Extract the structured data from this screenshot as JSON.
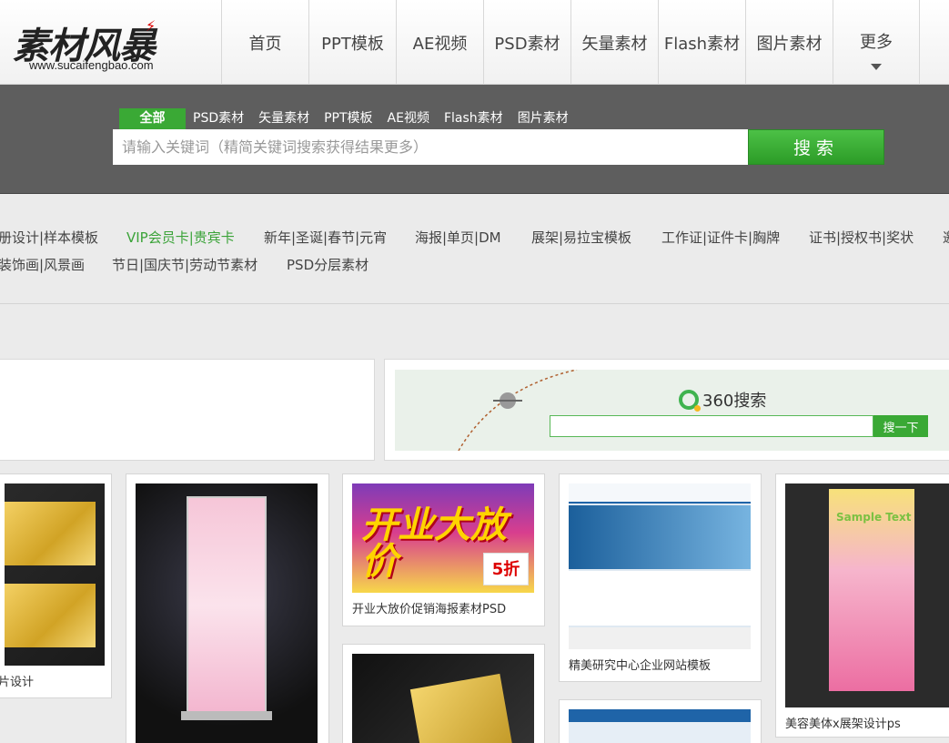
{
  "logo": {
    "name": "素材风暴",
    "url": "www.sucaifengbao.com"
  },
  "nav": [
    {
      "label": "首页"
    },
    {
      "label": "PPT模板"
    },
    {
      "label": "AE视频"
    },
    {
      "label": "PSD素材"
    },
    {
      "label": "矢量素材"
    },
    {
      "label": "Flash素材"
    },
    {
      "label": "图片素材"
    },
    {
      "label": "更多"
    }
  ],
  "search": {
    "tabs": [
      {
        "label": "全部",
        "active": true
      },
      {
        "label": "PSD素材"
      },
      {
        "label": "矢量素材"
      },
      {
        "label": "PPT模板"
      },
      {
        "label": "AE视频"
      },
      {
        "label": "Flash素材"
      },
      {
        "label": "图片素材"
      }
    ],
    "placeholder": "请输入关键词（精简关键词搜索获得结果更多）",
    "button": "搜索"
  },
  "categories": {
    "row1": [
      {
        "label": "册设计|样本模板"
      },
      {
        "label": "VIP会员卡|贵宾卡",
        "highlight": true
      },
      {
        "label": "新年|圣诞|春节|元宵"
      },
      {
        "label": "海报|单页|DM"
      },
      {
        "label": "展架|易拉宝模板"
      },
      {
        "label": "工作证|证件卡|胸牌"
      },
      {
        "label": "证书|授权书|奖状"
      },
      {
        "label": "邀"
      }
    ],
    "row2": [
      {
        "label": "装饰画|风景画"
      },
      {
        "label": "节日|国庆节|劳动节素材"
      },
      {
        "label": "PSD分层素材"
      }
    ]
  },
  "ad360": {
    "brand": "360搜索",
    "button": "搜一下"
  },
  "cards": [
    {
      "caption": "名片设计"
    },
    {
      "caption": ""
    },
    {
      "caption": "开业大放价促销海报素材PSD",
      "promo_text": "开业大放价",
      "promo_badge": "5折"
    },
    {
      "caption": "精美研究中心企业网站模板"
    },
    {
      "caption": "美容美体x展架设计ps",
      "poster_title": "Sample Text"
    }
  ],
  "colors": {
    "accent_green": "#3aa935",
    "search_band": "#5e5e5e"
  }
}
